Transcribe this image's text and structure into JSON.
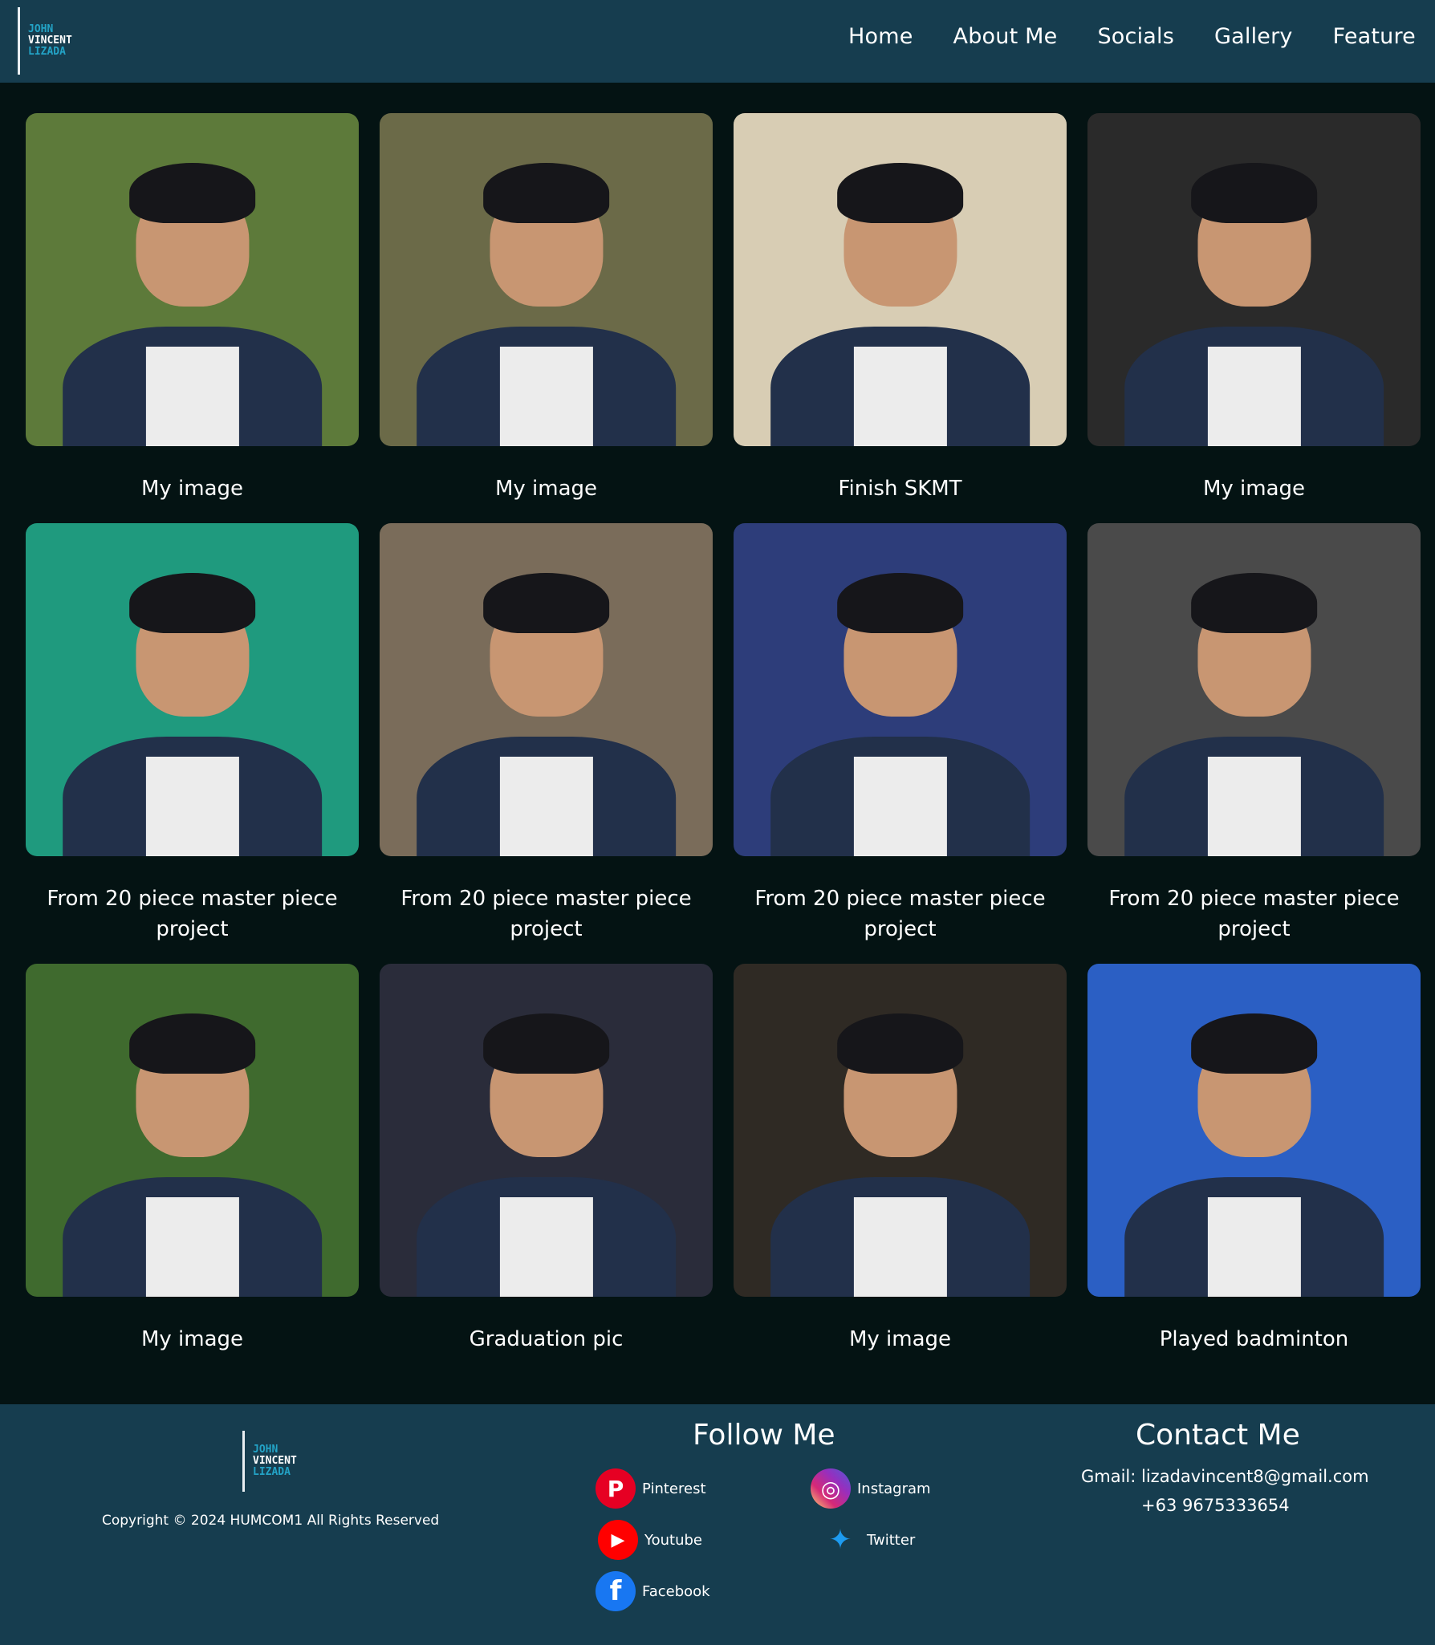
{
  "header": {
    "logo_lines": [
      "JOHN",
      "VINCENT",
      "LIZADA"
    ],
    "nav": [
      "Home",
      "About Me",
      "Socials",
      "Gallery",
      "Feature"
    ]
  },
  "gallery": [
    {
      "caption": "My image",
      "bg": "#5d7a3a"
    },
    {
      "caption": "My image",
      "bg": "#6b6a48"
    },
    {
      "caption": "Finish SKMT",
      "bg": "#d8cdb4"
    },
    {
      "caption": "My image",
      "bg": "#2a2a2a"
    },
    {
      "caption": "From 20 piece master piece project",
      "bg": "#1f9a7e"
    },
    {
      "caption": "From 20 piece master piece project",
      "bg": "#7a6c5a"
    },
    {
      "caption": "From 20 piece master piece project",
      "bg": "#2d3d7a"
    },
    {
      "caption": "From 20 piece master piece project",
      "bg": "#4a4a4a"
    },
    {
      "caption": "My image",
      "bg": "#3f6a2e"
    },
    {
      "caption": "Graduation pic",
      "bg": "#2a2c3a"
    },
    {
      "caption": "My image",
      "bg": "#2f2a24"
    },
    {
      "caption": "Played badminton",
      "bg": "#2b5fc4"
    }
  ],
  "footer": {
    "logo_lines": [
      "JOHN",
      "VINCENT",
      "LIZADA"
    ],
    "copyright": "Copyright © 2024 HUMCOM1 All Rights Reserved",
    "follow_title": "Follow Me",
    "socials": [
      {
        "label": "Pinterest",
        "icon": "pinterest-icon",
        "color": "#e60023",
        "glyph": "P"
      },
      {
        "label": "Instagram",
        "icon": "instagram-icon",
        "color": "#d6246e",
        "glyph": "◎"
      },
      {
        "label": "Youtube",
        "icon": "youtube-icon",
        "color": "#ff0000",
        "glyph": "▶"
      },
      {
        "label": "Twitter",
        "icon": "twitter-icon",
        "color": "#1d9bf0",
        "glyph": "🐦"
      },
      {
        "label": "Facebook",
        "icon": "facebook-icon",
        "color": "#1877f2",
        "glyph": "f"
      }
    ],
    "contact_title": "Contact Me",
    "gmail": "Gmail: lizadavincent8@gmail.com",
    "phone": "+63 9675333654"
  }
}
